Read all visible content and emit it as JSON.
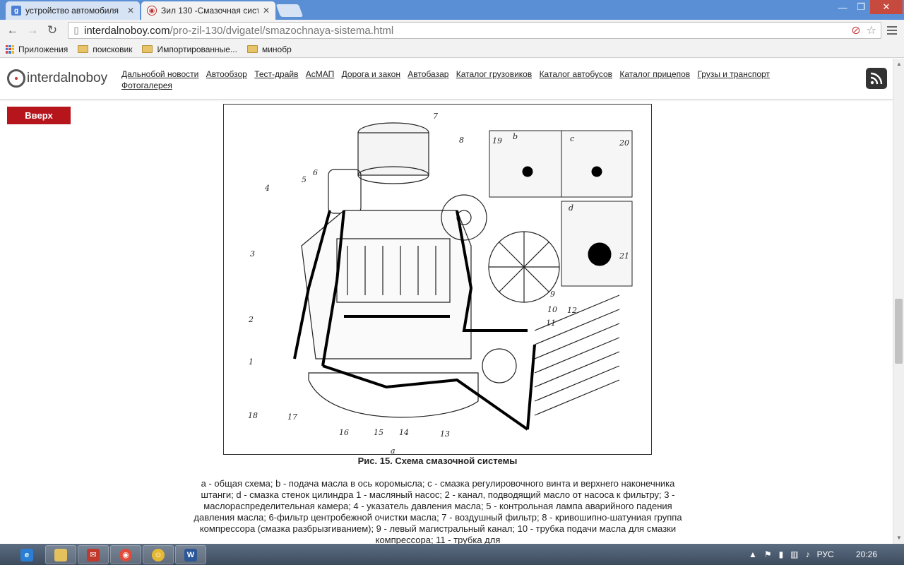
{
  "browser": {
    "tabs": [
      {
        "label": "устройство автомобиля",
        "active": false,
        "favicon": "google-icon"
      },
      {
        "label": "Зил 130 -Смазочная сист",
        "active": true,
        "favicon": "site-icon"
      }
    ],
    "url_host": "interdalnoboy.com",
    "url_path": "/pro-zil-130/dvigatel/smazochnaya-sistema.html",
    "bookmarks": {
      "apps_label": "Приложения",
      "folders": [
        "поисковик",
        "Импортированные...",
        "минобр"
      ]
    }
  },
  "site": {
    "logo_text": "interdalnoboy",
    "nav": [
      "Дальнобой новости",
      "Автообзор",
      "Тест-драйв",
      "АсМАП",
      "Дорога и закон",
      "Автобазар",
      "Каталог грузовиков",
      "Каталог автобусов",
      "Каталог прицепов",
      "Грузы и транспорт",
      "Фотогалерея"
    ],
    "up_button": "Вверх"
  },
  "figure": {
    "caption": "Рис. 15. Схема смазочной системы",
    "panel_labels": [
      "b",
      "c",
      "d"
    ],
    "bottom_label": "a",
    "numbers": [
      "1",
      "2",
      "3",
      "4",
      "5",
      "6",
      "7",
      "8",
      "9",
      "10",
      "11",
      "12",
      "13",
      "14",
      "15",
      "16",
      "17",
      "18",
      "19",
      "20",
      "21"
    ],
    "description": "a - общая схема; b - подача масла в ось коромысла; c - смазка регулировочного винта и верхнего наконечника штанги; d - смазка стенок цилиндра 1 - масляный насос; 2 - канал, подводящий масло от насоса к фильтру; 3 - маслораспределительная камера; 4 - указатель давления масла; 5 - контрольная лампа аварийного падения давления масла; 6-фильтр центробежной очистки масла; 7 - воздушный фильтр; 8 - кривошипно-шатуниая группа компрессора (смазка разбрызгиванием); 9 - левый магистральный канал; 10 - трубка подачи масла для смазки компрессора; 11 - трубка для"
  },
  "taskbar": {
    "lang": "РУС",
    "time": "20:26"
  }
}
